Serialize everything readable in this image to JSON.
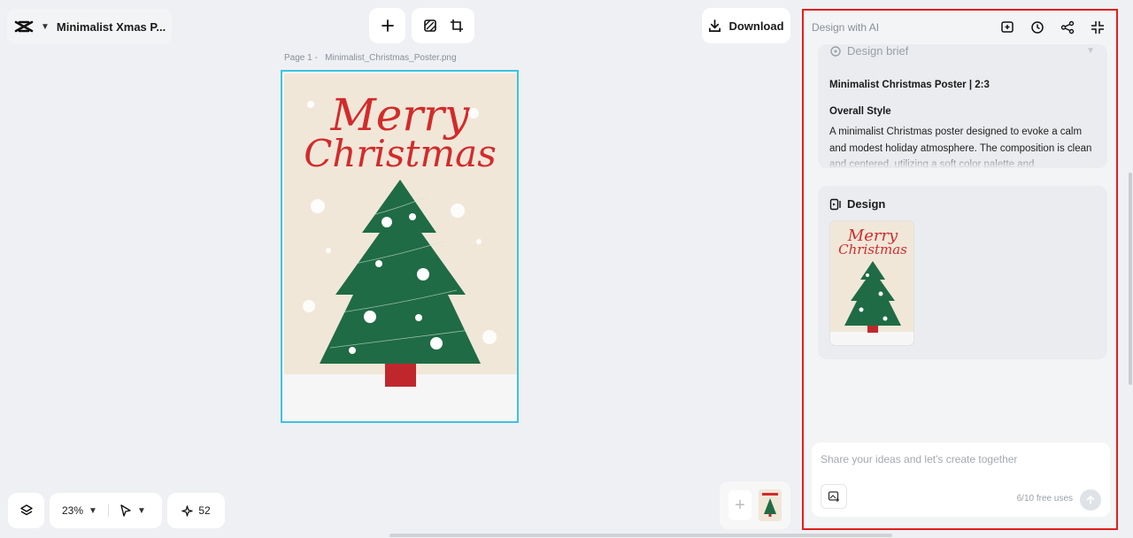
{
  "project": {
    "title": "Minimalist Xmas P..."
  },
  "toolbar": {
    "download_label": "Download"
  },
  "canvas": {
    "page_label": "Page 1 -",
    "file_name": "Minimalist_Christmas_Poster.png",
    "poster_line1": "Merry",
    "poster_line2": "Christmas"
  },
  "bottom": {
    "zoom": "23%",
    "credits": "52"
  },
  "panel": {
    "title": "Design with AI",
    "brief": {
      "heading": "Design brief",
      "subtitle": "Minimalist Christmas Poster | 2:3",
      "style_heading": "Overall Style",
      "text": "A minimalist Christmas poster designed to evoke a calm and modest holiday atmosphere. The composition is clean and centered, utilizing a soft color palette and"
    },
    "design": {
      "heading": "Design",
      "thumb_line1": "Merry",
      "thumb_line2": "Christmas"
    },
    "input": {
      "placeholder": "Share your ideas and let's create together",
      "uses": "6/10 free uses"
    }
  },
  "colors": {
    "accent_red": "#d22b2b",
    "tree_green": "#1f6b45",
    "selection": "#3cc3e0",
    "panel_border": "#e0201e"
  }
}
